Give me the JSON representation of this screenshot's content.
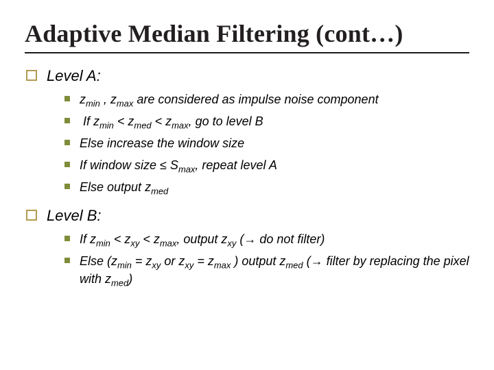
{
  "title": "Adaptive Median Filtering (cont…)",
  "levels": [
    {
      "label_pre": "Level ",
      "label_var": "A",
      "label_post": ":",
      "items": [
        "z<sub>min</sub> , z<sub>max</sub> are considered as impulse noise component",
        "&nbsp;If z<sub>min</sub> &lt; z<sub>med</sub> &lt; z<sub>max</sub>, go to level B",
        "Else increase the window size",
        "If window size ≤ S<sub>max</sub>, repeat level A",
        "Else output z<sub>med</sub>"
      ]
    },
    {
      "label_pre": "Level ",
      "label_var": "B",
      "label_post": ":",
      "items": [
        "If z<sub>min</sub> &lt; z<sub>xy</sub> &lt; z<sub>max</sub>, output z<sub>xy</sub> (→ do not filter)",
        "Else  (z<sub>min</sub> = z<sub>xy</sub> or z<sub>xy</sub> = z<sub>max</sub> ) output z<sub>med</sub> (→ filter by replacing the pixel with z<sub>med</sub>)"
      ]
    }
  ]
}
